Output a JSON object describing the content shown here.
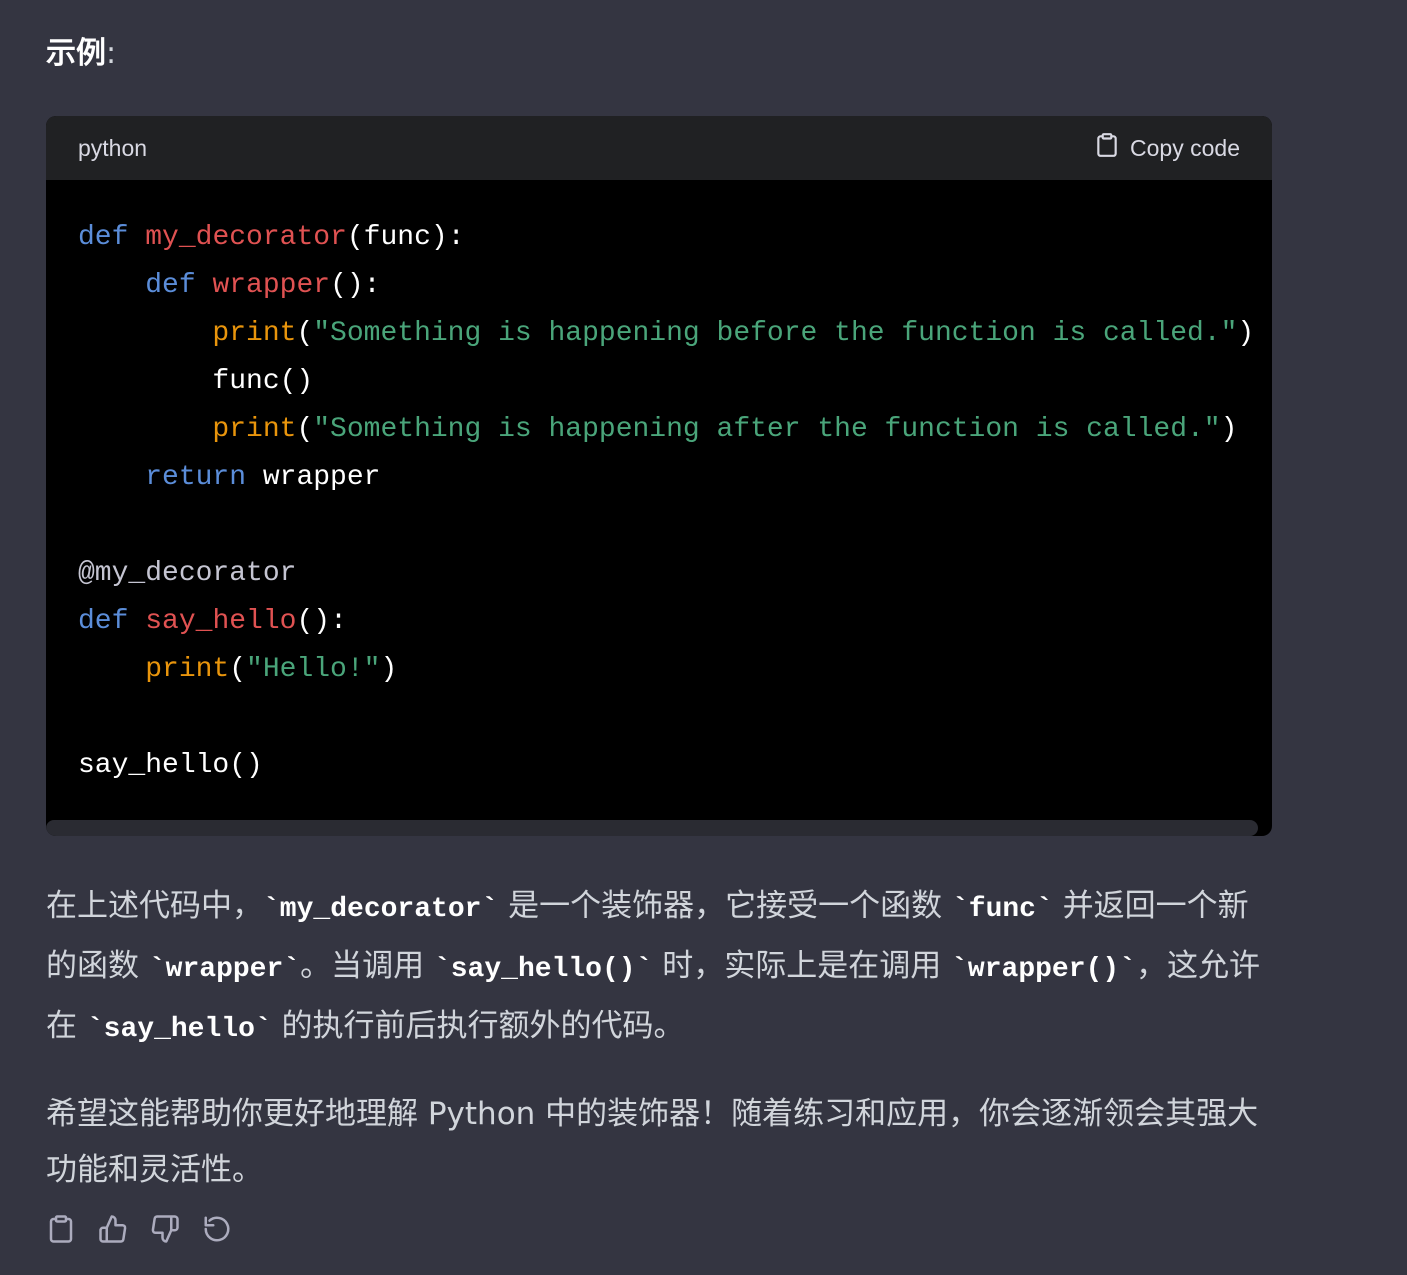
{
  "heading": {
    "text": "示例",
    "colon": ":"
  },
  "code_block": {
    "language": "python",
    "copy_label": "Copy code"
  },
  "code_lines": [
    [
      [
        "kw",
        "def"
      ],
      [
        "p",
        " "
      ],
      [
        "fn",
        "my_decorator"
      ],
      [
        "p",
        "(func):"
      ]
    ],
    [
      [
        "p",
        "    "
      ],
      [
        "kw",
        "def"
      ],
      [
        "p",
        " "
      ],
      [
        "fn",
        "wrapper"
      ],
      [
        "p",
        "():"
      ]
    ],
    [
      [
        "p",
        "        "
      ],
      [
        "bi",
        "print"
      ],
      [
        "p",
        "("
      ],
      [
        "str",
        "\"Something is happening before the function is called.\""
      ],
      [
        "p",
        ")"
      ]
    ],
    [
      [
        "p",
        "        func()"
      ]
    ],
    [
      [
        "p",
        "        "
      ],
      [
        "bi",
        "print"
      ],
      [
        "p",
        "("
      ],
      [
        "str",
        "\"Something is happening after the function is called.\""
      ],
      [
        "p",
        ")"
      ]
    ],
    [
      [
        "p",
        "    "
      ],
      [
        "kw",
        "return"
      ],
      [
        "p",
        " wrapper"
      ]
    ],
    [
      [
        "p",
        ""
      ]
    ],
    [
      [
        "dec",
        "@my_decorator"
      ]
    ],
    [
      [
        "kw",
        "def"
      ],
      [
        "p",
        " "
      ],
      [
        "fn",
        "say_hello"
      ],
      [
        "p",
        "():"
      ]
    ],
    [
      [
        "p",
        "    "
      ],
      [
        "bi",
        "print"
      ],
      [
        "p",
        "("
      ],
      [
        "str",
        "\"Hello!\""
      ],
      [
        "p",
        ")"
      ]
    ],
    [
      [
        "p",
        ""
      ]
    ],
    [
      [
        "p",
        "say_hello()"
      ]
    ]
  ],
  "explanation": [
    [
      "t",
      "在上述代码中，"
    ],
    [
      "c",
      "`my_decorator`"
    ],
    [
      "t",
      " 是一个装饰器，它接受一个函数 "
    ],
    [
      "c",
      "`func`"
    ],
    [
      "t",
      " 并返回一个新的函数 "
    ],
    [
      "c",
      "`wrapper`"
    ],
    [
      "t",
      "。当调用 "
    ],
    [
      "c",
      "`say_hello()`"
    ],
    [
      "t",
      " 时，实际上是在调用 "
    ],
    [
      "c",
      "`wrapper()`"
    ],
    [
      "t",
      "，这允许在 "
    ],
    [
      "c",
      "`say_hello`"
    ],
    [
      "t",
      " 的执行前后执行额外的代码。"
    ]
  ],
  "closing": "希望这能帮助你更好地理解 Python 中的装饰器！随着练习和应用，你会逐渐领会其强大功能和灵活性。",
  "actions": [
    "clipboard-icon",
    "thumbs-up-icon",
    "thumbs-down-icon",
    "regenerate-icon"
  ]
}
